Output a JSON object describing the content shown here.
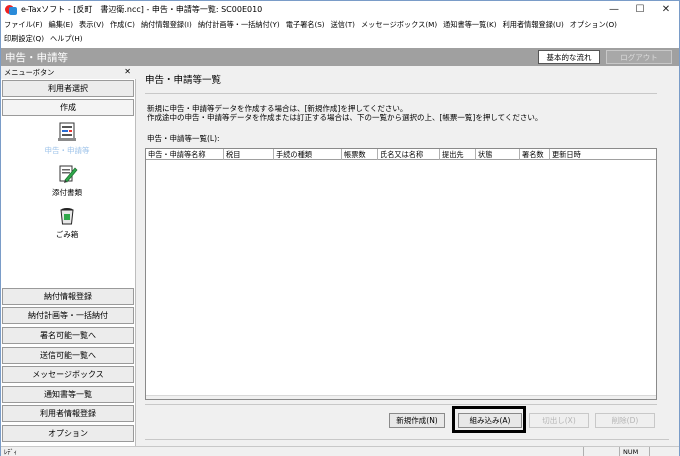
{
  "window": {
    "title": "e-Taxソフト - [反町　書辺衛.ncc] - 申告・申請等一覧: SC00E010",
    "controls": [
      "—",
      "☐",
      "✕"
    ]
  },
  "menu": {
    "row1": [
      "ファイル(F)",
      "編集(E)",
      "表示(V)",
      "作成(C)",
      "納付情報登録(I)",
      "納付計画等・一括納付(Y)",
      "電子署名(S)",
      "送信(T)",
      "メッセージボックス(M)",
      "通知書等一覧(K)",
      "利用者情報登録(U)",
      "オプション(O)"
    ],
    "row2": [
      "印刷設定(Q)",
      "ヘルプ(H)"
    ]
  },
  "screen": {
    "title": "申告・申請等",
    "flow_button": "基本的な流れ",
    "logout_button": "ログアウト"
  },
  "left_panel": {
    "header": "メニューボタン",
    "close": "✕",
    "user_select": "利用者選択",
    "create": "作成",
    "tools": [
      {
        "label": "申告・申請等",
        "icon": "document-form-icon"
      },
      {
        "label": "添付書類",
        "icon": "attachment-pen-icon"
      },
      {
        "label": "ごみ箱",
        "icon": "trash-bin-icon"
      }
    ],
    "nav": [
      "納付情報登録",
      "納付計画等・一括納付",
      "署名可能一覧へ",
      "送信可能一覧へ",
      "メッセージボックス",
      "通知書等一覧",
      "利用者情報登録",
      "オプション"
    ]
  },
  "main": {
    "title": "申告・申請等一覧",
    "instructions": [
      "新規に申告・申請等データを作成する場合は、[新規作成]を押してください。",
      "作成途中の申告・申請等データを作成または訂正する場合は、下の一覧から選択の上、[帳票一覧]を押してください。"
    ],
    "list_label": "申告・申請等一覧(L):",
    "columns": [
      "申告・申請等名称",
      "税目",
      "手続の種類",
      "帳票数",
      "氏名又は名称",
      "提出先",
      "状態",
      "署名数",
      "更新日時"
    ],
    "buttons": {
      "new": "新規作成(N)",
      "import": "組み込み(A)",
      "export": "切出し(X)",
      "delete": "削除(D)"
    }
  },
  "status": {
    "text": "ﾚﾃﾞｨ",
    "num": "NUM"
  }
}
